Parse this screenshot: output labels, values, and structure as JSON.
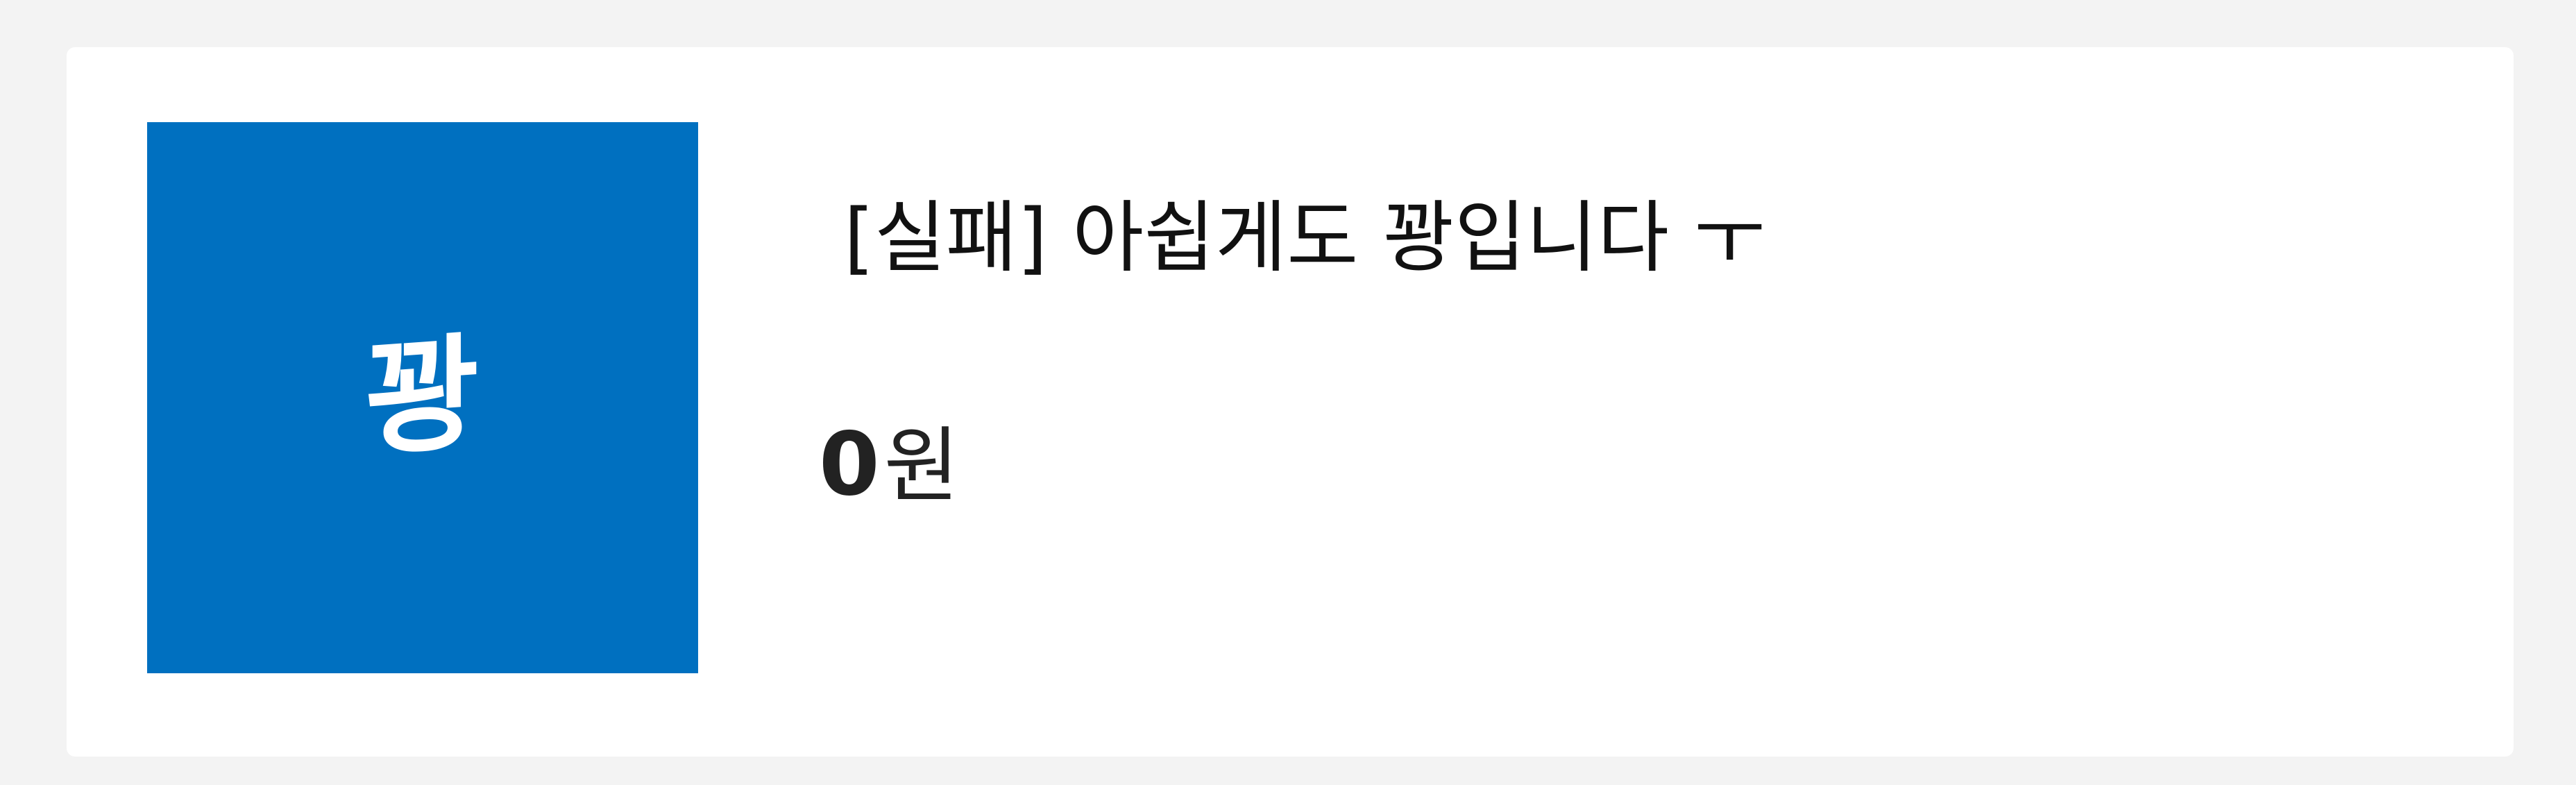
{
  "card": {
    "thumbnail": {
      "text": "꽝",
      "background_color": "#0070c0",
      "text_color": "#ffffff"
    },
    "title": "[실패] 아쉽게도 꽝입니다 ㅜ",
    "price": {
      "amount": "0",
      "unit": "원"
    }
  },
  "colors": {
    "page_background": "#f3f3f3",
    "card_background": "#ffffff",
    "accent": "#0070c0",
    "text": "#111111"
  }
}
